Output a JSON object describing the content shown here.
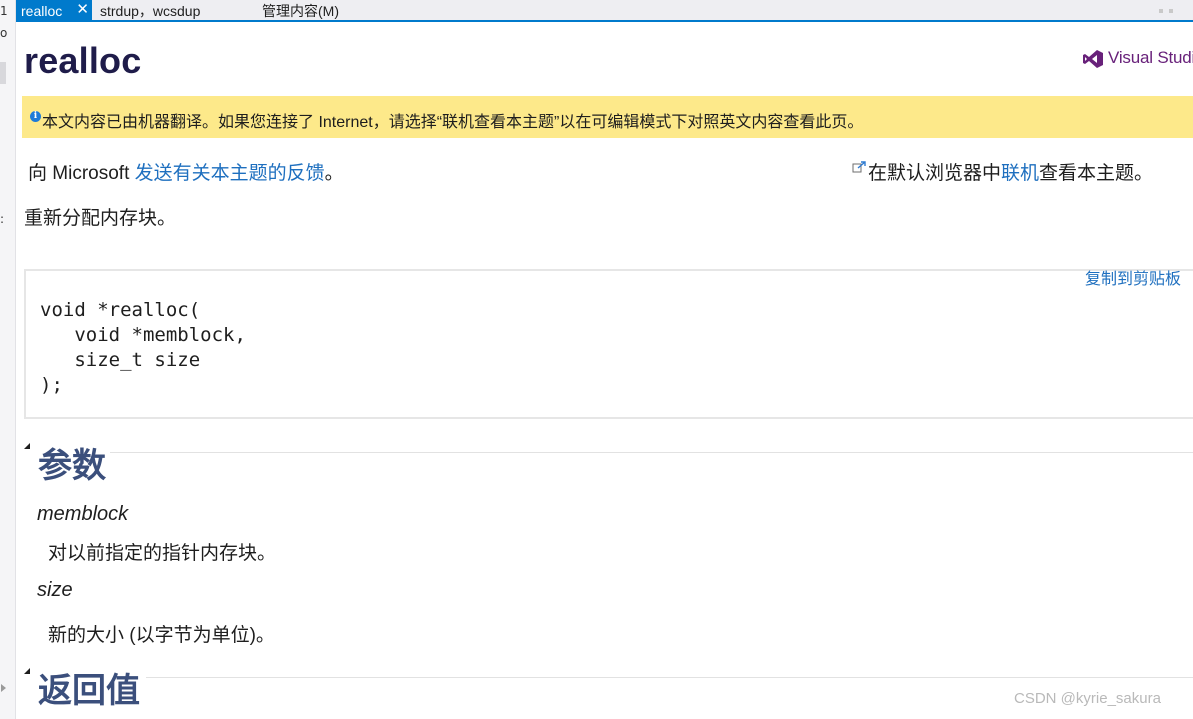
{
  "gutter": {
    "top_char": "1",
    "second_char": "o",
    "mid_char": ":"
  },
  "tabs": [
    {
      "label": "realloc",
      "active": true,
      "close_icon": "close-icon"
    },
    {
      "label": "strdup，wcsdup",
      "active": false
    },
    {
      "label": "管理内容(M)",
      "active": false
    }
  ],
  "header": {
    "title": "realloc",
    "logo_text": "Visual Studio",
    "logo_color": "#68217a"
  },
  "banner": {
    "icon": "info-icon",
    "text": "本文内容已由机器翻译。如果您连接了 Internet，请选择“联机查看本主题”以在可编辑模式下对照英文内容查看此页。",
    "background": "#fde98a"
  },
  "feedback": {
    "prefix": "向  Microsoft ",
    "link": "发送有关本主题的反馈",
    "suffix": "。"
  },
  "online": {
    "icon": "external-link-icon",
    "prefix": "在默认浏览器中",
    "link": "联机",
    "suffix": "查看本主题。"
  },
  "summary": "重新分配内存块。",
  "syntax": {
    "copy_label": "复制到剪贴板",
    "code": "void *realloc(\n   void *memblock,\n   size_t size\n);"
  },
  "sections": {
    "parameters_title": "参数",
    "return_title": "返回值"
  },
  "parameters": [
    {
      "name": "memblock",
      "desc": "对以前指定的指针内存块。"
    },
    {
      "name": "size",
      "desc": "新的大小 (以字节为单位)。"
    }
  ],
  "watermark": "CSDN @kyrie_sakura",
  "colors": {
    "tab_accent": "#007acc",
    "link": "#1e6fbf",
    "heading": "#3b4f7c",
    "title": "#1f1c4a"
  }
}
